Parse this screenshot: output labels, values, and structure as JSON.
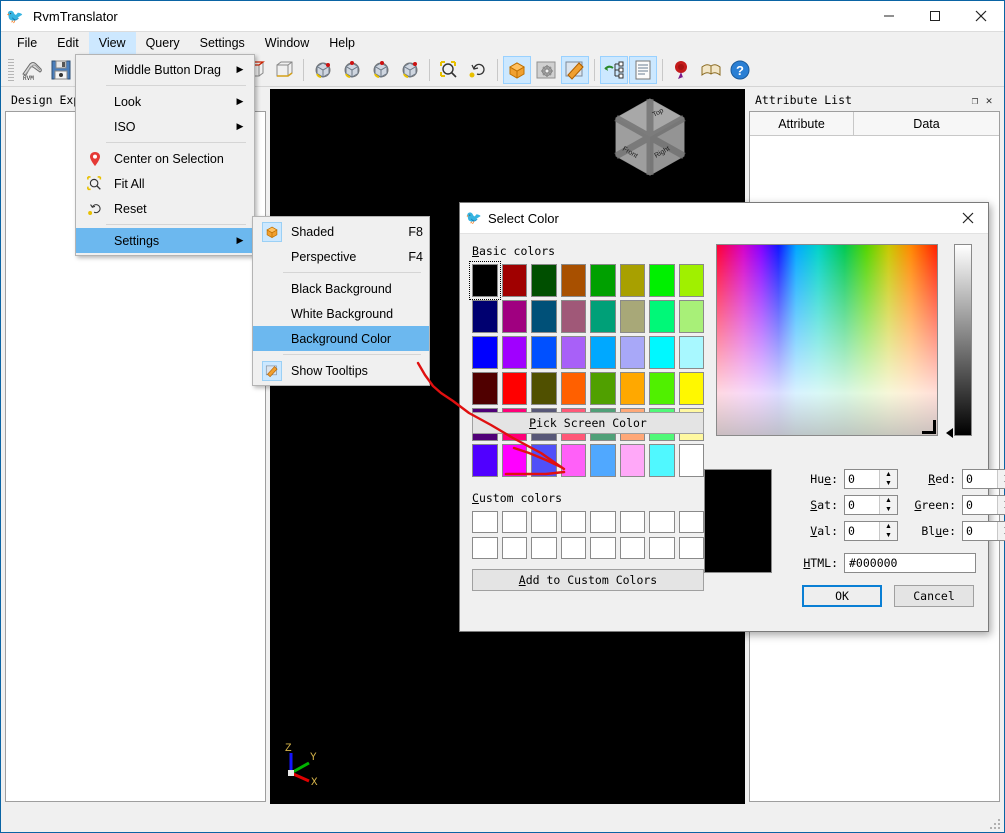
{
  "window": {
    "title": "RvmTranslator",
    "app_icon": "bird-icon",
    "controls": {
      "minimize": "—",
      "maximize": "▢",
      "close": "✕"
    }
  },
  "menubar": {
    "items": [
      {
        "label": "File",
        "active": false
      },
      {
        "label": "Edit",
        "active": false
      },
      {
        "label": "View",
        "active": true
      },
      {
        "label": "Query",
        "active": false
      },
      {
        "label": "Settings",
        "active": false
      },
      {
        "label": "Window",
        "active": false
      },
      {
        "label": "Help",
        "active": false
      }
    ]
  },
  "toolbar": {
    "groups": [
      {
        "buttons": [
          {
            "name": "open-rvm-button",
            "icon": "rvm-folder-icon",
            "active": false
          },
          {
            "name": "save-button",
            "icon": "floppy-disk-icon",
            "active": false
          }
        ]
      },
      {
        "buttons": [
          {
            "name": "rotate-button",
            "icon": "rotate-icon",
            "active": true
          }
        ]
      },
      {
        "buttons": [
          {
            "name": "view-front-button",
            "icon": "cube-front-icon",
            "active": false
          },
          {
            "name": "view-back-button",
            "icon": "cube-back-icon",
            "active": false
          },
          {
            "name": "view-left-button",
            "icon": "cube-left-icon",
            "active": false
          },
          {
            "name": "view-right-button",
            "icon": "cube-right-icon",
            "active": false
          },
          {
            "name": "view-top-button",
            "icon": "cube-top-icon",
            "active": false
          },
          {
            "name": "view-bottom-button",
            "icon": "cube-bottom-icon",
            "active": false
          }
        ]
      },
      {
        "buttons": [
          {
            "name": "iso-view-1-button",
            "icon": "iso-cube-1-icon",
            "active": false
          },
          {
            "name": "iso-view-2-button",
            "icon": "iso-cube-2-icon",
            "active": false
          },
          {
            "name": "iso-view-3-button",
            "icon": "iso-cube-3-icon",
            "active": false
          },
          {
            "name": "iso-view-4-button",
            "icon": "iso-cube-4-icon",
            "active": false
          }
        ]
      },
      {
        "buttons": [
          {
            "name": "fit-all-button",
            "icon": "magnifier-fit-icon",
            "active": false
          },
          {
            "name": "reset-button",
            "icon": "reset-icon",
            "active": false
          }
        ]
      },
      {
        "buttons": [
          {
            "name": "shaded-button",
            "icon": "orange-cube-icon",
            "active": true
          },
          {
            "name": "settings-button",
            "icon": "gear-icon",
            "active": false
          },
          {
            "name": "tooltips-button",
            "icon": "tag-pencil-icon",
            "active": true
          }
        ]
      },
      {
        "buttons": [
          {
            "name": "design-explorer-button",
            "icon": "tree-icon",
            "active": true
          },
          {
            "name": "attribute-list-button",
            "icon": "list-icon",
            "active": true
          }
        ]
      },
      {
        "buttons": [
          {
            "name": "bookmark-button",
            "icon": "wax-seal-icon",
            "active": false
          },
          {
            "name": "manual-button",
            "icon": "open-book-icon",
            "active": false
          },
          {
            "name": "help-button",
            "icon": "question-icon",
            "active": false
          }
        ]
      }
    ]
  },
  "view_menu": {
    "items": [
      {
        "type": "item",
        "label": "Middle Button Drag",
        "icon": "",
        "submenu": true,
        "accel": "",
        "selected": false
      },
      {
        "type": "sep"
      },
      {
        "type": "item",
        "label": "Look",
        "icon": "",
        "submenu": true,
        "accel": "",
        "selected": false
      },
      {
        "type": "item",
        "label": "ISO",
        "icon": "",
        "submenu": true,
        "accel": "",
        "selected": false
      },
      {
        "type": "sep"
      },
      {
        "type": "item",
        "label": "Center on Selection",
        "icon": "map-pin-icon",
        "submenu": false,
        "accel": "",
        "selected": false
      },
      {
        "type": "item",
        "label": "Fit All",
        "icon": "magnifier-fit-icon",
        "submenu": false,
        "accel": "",
        "selected": false
      },
      {
        "type": "item",
        "label": "Reset",
        "icon": "reset-icon",
        "submenu": false,
        "accel": "",
        "selected": false
      },
      {
        "type": "sep"
      },
      {
        "type": "item",
        "label": "Settings",
        "icon": "",
        "submenu": true,
        "accel": "",
        "selected": true
      }
    ]
  },
  "settings_submenu": {
    "items": [
      {
        "type": "item",
        "label": "Shaded",
        "icon": "orange-cube-icon",
        "accel": "F8",
        "selected": false
      },
      {
        "type": "item",
        "label": "Perspective",
        "icon": "",
        "accel": "F4",
        "selected": false
      },
      {
        "type": "sep"
      },
      {
        "type": "item",
        "label": "Black Background",
        "icon": "",
        "accel": "",
        "selected": false
      },
      {
        "type": "item",
        "label": "White Background",
        "icon": "",
        "accel": "",
        "selected": false
      },
      {
        "type": "item",
        "label": "Background Color",
        "icon": "",
        "accel": "",
        "selected": true
      },
      {
        "type": "sep"
      },
      {
        "type": "item",
        "label": "Show Tooltips",
        "icon": "tag-pencil-icon",
        "accel": "",
        "selected": false
      }
    ]
  },
  "left_panel": {
    "title": "Design Expl"
  },
  "right_panel": {
    "title": "Attribute List",
    "buttons": [
      {
        "name": "float-button",
        "glyph": "❐"
      },
      {
        "name": "close-button",
        "glyph": "✕"
      }
    ],
    "columns": [
      "Attribute",
      "Data"
    ],
    "rows": []
  },
  "viewport": {
    "background": "#000000",
    "viewcube_labels": [
      "Top",
      "Front",
      "Right"
    ],
    "axes": [
      {
        "label": "Z",
        "color": "#0000ff"
      },
      {
        "label": "Y",
        "color": "#00c000"
      },
      {
        "label": "X",
        "color": "#e00000"
      }
    ]
  },
  "color_dialog": {
    "title": "Select Color",
    "icon": "bird-icon",
    "close_glyph": "✕",
    "basic_colors_label": "Basic colors",
    "basic_colors_accel": "B",
    "custom_colors_label": "Custom colors",
    "custom_colors_accel": "C",
    "basic_colors": [
      [
        "#000000",
        "#a00000",
        "#004f00",
        "#a85000",
        "#00a000",
        "#a8a000",
        "#00f000",
        "#a0f000"
      ],
      [
        "#000070",
        "#a00080",
        "#005078",
        "#a05878",
        "#00a078",
        "#a8a878",
        "#00f878",
        "#a8f078"
      ],
      [
        "#0000ff",
        "#a000ff",
        "#0050ff",
        "#a860f8",
        "#00a8ff",
        "#a8a8f8",
        "#00f8ff",
        "#a8f8ff"
      ],
      [
        "#500000",
        "#ff0000",
        "#505000",
        "#ff6000",
        "#50a000",
        "#ffa800",
        "#50f000",
        "#fff800"
      ],
      [
        "#500078",
        "#ff0078",
        "#585878",
        "#ff5878",
        "#50a078",
        "#ffa878",
        "#50f878",
        "#fff8a0"
      ],
      [
        "#5000ff",
        "#ff00ff",
        "#5050f8",
        "#ff60f8",
        "#50a8ff",
        "#ffa8f8",
        "#50f8ff",
        "#ffffff"
      ]
    ],
    "selected_basic": {
      "row": 0,
      "col": 0
    },
    "custom_colors_rows": 2,
    "custom_colors_cols": 8,
    "pick_screen_color_label": "Pick Screen Color",
    "pick_screen_color_accel": "P",
    "add_custom_label": "Add to Custom Colors",
    "add_custom_accel": "A",
    "preview_color": "#000000",
    "fields": [
      {
        "name": "hue",
        "label": "Hue:",
        "accel": "e",
        "value": "0"
      },
      {
        "name": "sat",
        "label": "Sat:",
        "accel": "S",
        "value": "0"
      },
      {
        "name": "val",
        "label": "Val:",
        "accel": "V",
        "value": "0"
      },
      {
        "name": "red",
        "label": "Red:",
        "accel": "R",
        "value": "0"
      },
      {
        "name": "green",
        "label": "Green:",
        "accel": "G",
        "value": "0"
      },
      {
        "name": "blue",
        "label": "Blue:",
        "accel": "u",
        "value": "0"
      }
    ],
    "html_label": "HTML:",
    "html_value": "#000000",
    "ok_label": "OK",
    "cancel_label": "Cancel"
  },
  "annotation": {
    "color": "#e01010",
    "shape": "hand-drawn-arrow"
  }
}
